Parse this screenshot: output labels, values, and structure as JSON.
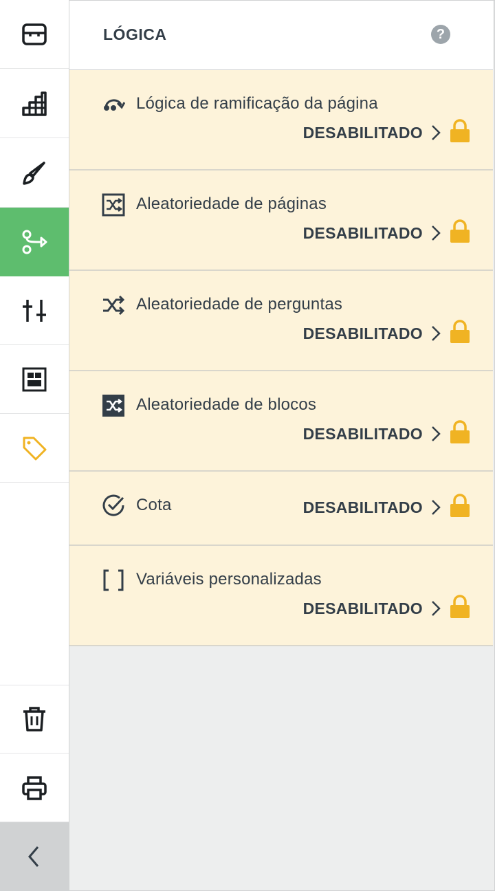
{
  "sidebar": {
    "items": [
      {
        "name": "library-icon"
      },
      {
        "name": "chart-icon"
      },
      {
        "name": "paintbrush-icon"
      },
      {
        "name": "logic-icon",
        "active": true
      },
      {
        "name": "sliders-icon"
      },
      {
        "name": "layout-icon"
      },
      {
        "name": "tag-icon"
      }
    ],
    "bottom_items": [
      {
        "name": "trash-icon"
      },
      {
        "name": "printer-icon"
      },
      {
        "name": "collapse-chevron-icon"
      }
    ],
    "colors": {
      "active": "#5ebd6e",
      "tag": "#f0b323"
    }
  },
  "panel": {
    "title": "LÓGICA",
    "help_icon": "?",
    "rows": [
      {
        "icon": "page-branching-icon",
        "label": "Lógica de ramificação da página",
        "status": "DESABILITADO"
      },
      {
        "icon": "page-randomization-icon",
        "label": "Aleatoriedade de páginas",
        "status": "DESABILITADO"
      },
      {
        "icon": "question-randomization-icon",
        "label": "Aleatoriedade de perguntas",
        "status": "DESABILITADO"
      },
      {
        "icon": "block-randomization-icon",
        "label": "Aleatoriedade de blocos",
        "status": "DESABILITADO"
      },
      {
        "icon": "quota-check-icon",
        "label": "Cota",
        "status": "DESABILITADO"
      },
      {
        "icon": "brackets-icon",
        "label": "Variáveis personalizadas",
        "status": "DESABILITADO"
      }
    ],
    "colors": {
      "row_bg": "#fdf3da",
      "lock": "#f0b323",
      "panel_bg": "#edeeee"
    }
  }
}
